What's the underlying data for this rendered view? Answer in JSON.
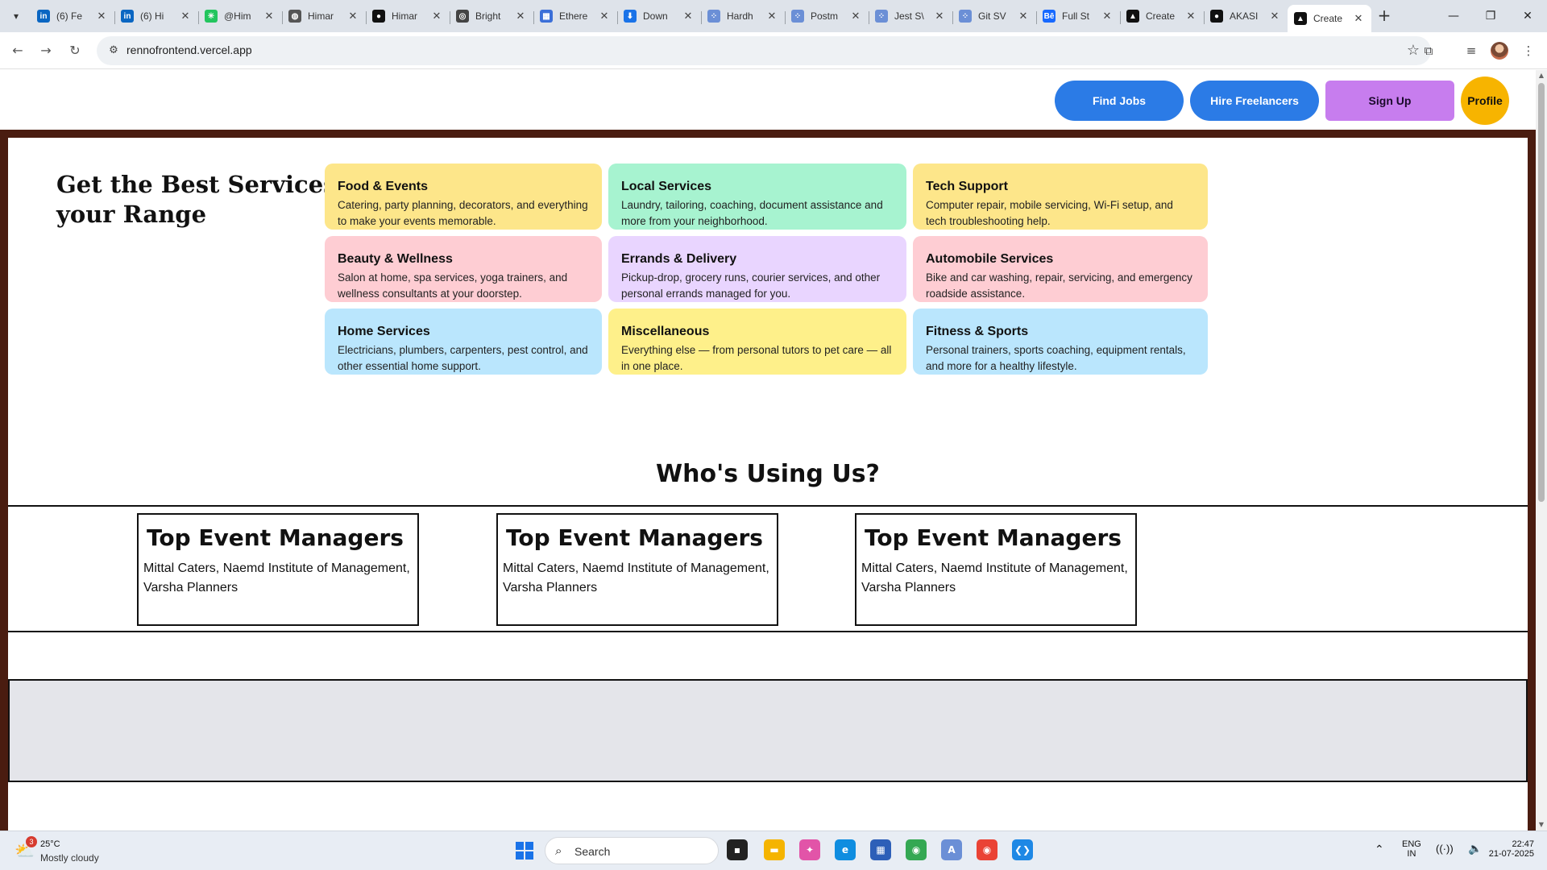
{
  "browser": {
    "tabs": [
      {
        "title": "(6) Fe",
        "icon": "linkedin-icon",
        "color": "#0a66c2",
        "glyph": "in"
      },
      {
        "title": "(6) Hi",
        "icon": "linkedin-icon",
        "color": "#0a66c2",
        "glyph": "in"
      },
      {
        "title": "@Him",
        "icon": "spark-icon",
        "color": "#22c55e",
        "glyph": "✳"
      },
      {
        "title": "Himar",
        "icon": "globe-icon",
        "color": "#555555",
        "glyph": "◍"
      },
      {
        "title": "Himar",
        "icon": "github-icon",
        "color": "#111111",
        "glyph": "●"
      },
      {
        "title": "Bright",
        "icon": "globe-icon",
        "color": "#444444",
        "glyph": "◎"
      },
      {
        "title": "Ethere",
        "icon": "grid-icon",
        "color": "#3b6fd8",
        "glyph": "▦"
      },
      {
        "title": "Down",
        "icon": "download-icon",
        "color": "#1a73e8",
        "glyph": "⬇"
      },
      {
        "title": "Hardh",
        "icon": "dots-icon",
        "color": "#6b8fd6",
        "glyph": "⁘"
      },
      {
        "title": "Postm",
        "icon": "dots-icon",
        "color": "#6b8fd6",
        "glyph": "⁘"
      },
      {
        "title": "Jest S\\",
        "icon": "dots-icon",
        "color": "#6b8fd6",
        "glyph": "⁘"
      },
      {
        "title": "Git SV",
        "icon": "dots-icon",
        "color": "#6b8fd6",
        "glyph": "⁘"
      },
      {
        "title": "Full St",
        "icon": "behance-icon",
        "color": "#1769ff",
        "glyph": "Bē"
      },
      {
        "title": "Create",
        "icon": "vercel-icon",
        "color": "#111111",
        "glyph": "▲"
      },
      {
        "title": "AKASI",
        "icon": "github-icon",
        "color": "#111111",
        "glyph": "●"
      },
      {
        "title": "Create",
        "icon": "vercel-icon",
        "color": "#111111",
        "glyph": "▲",
        "active": true
      }
    ],
    "url": "rennofrontend.vercel.app"
  },
  "site": {
    "nav": {
      "find_jobs": "Find Jobs",
      "hire_freelancers": "Hire Freelancers",
      "sign_up": "Sign Up",
      "profile": "Profile"
    },
    "hero_title": "Get the Best Services in your Range",
    "services": [
      {
        "title": "Food & Events",
        "desc": "Catering, party planning, decorators, and everything to make your events memorable.",
        "color": "#fde68a"
      },
      {
        "title": "Local Services",
        "desc": "Laundry, tailoring, coaching, document assistance and more from your neighborhood.",
        "color": "#a7f3d0"
      },
      {
        "title": "Tech Support",
        "desc": "Computer repair, mobile servicing, Wi-Fi setup, and tech troubleshooting help.",
        "color": "#fde68a"
      },
      {
        "title": "Beauty & Wellness",
        "desc": "Salon at home, spa services, yoga trainers, and wellness consultants at your doorstep.",
        "color": "#fecdd3"
      },
      {
        "title": "Errands & Delivery",
        "desc": "Pickup-drop, grocery runs, courier services, and other personal errands managed for you.",
        "color": "#e9d5ff"
      },
      {
        "title": "Automobile Services",
        "desc": "Bike and car washing, repair, servicing, and emergency roadside assistance.",
        "color": "#fecdd3"
      },
      {
        "title": "Home Services",
        "desc": "Electricians, plumbers, carpenters, pest control, and other essential home support.",
        "color": "#bae6fd"
      },
      {
        "title": "Miscellaneous",
        "desc": "Everything else — from personal tutors to pet care — all in one place.",
        "color": "#fef08a"
      },
      {
        "title": "Fitness & Sports",
        "desc": "Personal trainers, sports coaching, equipment rentals, and more for a healthy lifestyle.",
        "color": "#bae6fd"
      }
    ],
    "who_title": "Who's Using Us?",
    "users": [
      {
        "title": "Top Event Managers",
        "desc": "Mittal Caters, Naemd Institute of Management, Varsha Planners"
      },
      {
        "title": "Top Event Managers",
        "desc": "Mittal Caters, Naemd Institute of Management, Varsha Planners"
      },
      {
        "title": "Top Event Managers",
        "desc": "Mittal Caters, Naemd Institute of Management, Varsha Planners"
      }
    ]
  },
  "taskbar": {
    "weather_badge": "3",
    "temperature": "25°C",
    "condition": "Mostly cloudy",
    "search_placeholder": "Search",
    "lang_top": "ENG",
    "lang_bottom": "IN",
    "time": "22:47",
    "date": "21-07-2025"
  }
}
